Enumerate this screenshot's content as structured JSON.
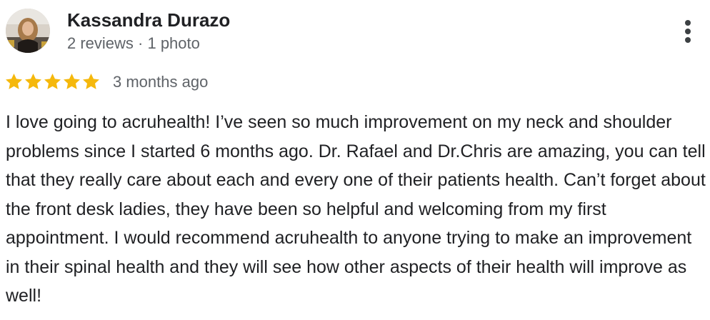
{
  "reviewer": {
    "name": "Kassandra Durazo",
    "meta": "2 reviews · 1 photo"
  },
  "rating": {
    "stars": 5,
    "max": 5,
    "star_color": "#f5b80c",
    "date": "3 months ago"
  },
  "review": {
    "text": "I love going to acruhealth! I’ve seen so much improvement on my neck and shoulder problems since I started 6 months ago. Dr. Rafael and Dr.Chris are amazing, you can tell that they really care about each and every one of their patients health. Can’t forget about the front desk ladies, they have been so helpful and welcoming from my first appointment. I would recommend acruhealth to anyone trying to make an improvement in their spinal health and they will see how other aspects of their health will improve as well!"
  },
  "icons": {
    "menu": "more-vertical-icon",
    "star": "star-icon"
  }
}
